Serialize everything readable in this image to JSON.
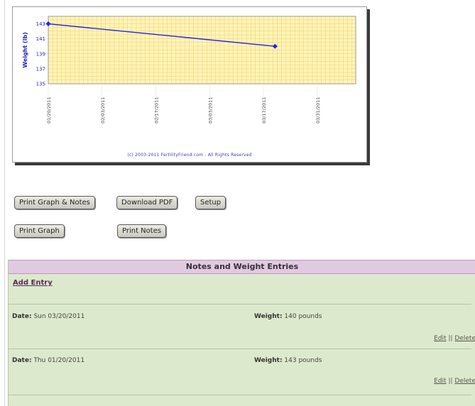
{
  "chart": {
    "ylabel": "Weight (lb)",
    "copyright": "(c) 2003-2011 FertilityFriend.com - All Rights Reserved",
    "colors": {
      "plot_bg": "#fff5b8",
      "grid": "#f2d27a",
      "line": "#2222ee",
      "axis_text": "#2222bb"
    }
  },
  "chart_data": {
    "type": "line",
    "x_ticks": [
      "01/20/2011",
      "02/03/2011",
      "02/17/2011",
      "03/03/2011",
      "03/17/2011",
      "03/31/2011"
    ],
    "y_ticks": [
      135,
      137,
      139,
      141,
      143
    ],
    "ylim": [
      135,
      144
    ],
    "ylabel": "Weight (lb)",
    "grid": true,
    "series": [
      {
        "points": [
          {
            "x": "01/20/2011",
            "y": 143
          },
          {
            "x": "03/20/2011",
            "y": 140
          }
        ]
      }
    ]
  },
  "buttons": {
    "print_graph_notes": "Print Graph & Notes",
    "download_pdf": "Download PDF",
    "setup": "Setup",
    "print_graph": "Print Graph",
    "print_notes": "Print Notes"
  },
  "notes": {
    "title": "Notes and Weight Entries",
    "add_entry": "Add Entry",
    "date_label": "Date:",
    "weight_label": "Weight:",
    "edit": "Edit",
    "separator": "||",
    "delete": "Delete",
    "entries": [
      {
        "date": "Sun 03/20/2011",
        "weight": "140 pounds"
      },
      {
        "date": "Thu 01/20/2011",
        "weight": "143 pounds"
      }
    ]
  }
}
